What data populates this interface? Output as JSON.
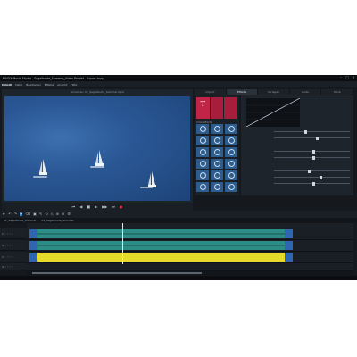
{
  "window": {
    "title": "MAGIX Movie Studio - Segelboote_Sommer_Video-Projekt - Export.mvp",
    "controls": [
      "–",
      "□",
      "✕"
    ]
  },
  "menu": {
    "items": [
      "MAGIX",
      "Datei",
      "Bearbeiten",
      "Effekte",
      "Ansicht",
      "Hilfe"
    ]
  },
  "preview": {
    "title": "Vorschau: 01_Segelboote_Sommer.mp4"
  },
  "transport": {
    "buttons": [
      "⏮",
      "◀",
      "■",
      "▶",
      "▶▶",
      "⏭",
      "●"
    ]
  },
  "right_tabs": [
    "Import",
    "Effekte",
    "Vorlagen",
    "Audio",
    "Store"
  ],
  "effects": {
    "title_tile": "T",
    "section_label": "Videoeffekte"
  },
  "toolbar": {
    "buttons": [
      "⇤",
      "↶",
      "↷",
      "✂",
      "⌫",
      "▣",
      "✎",
      "⟲",
      "◇",
      "⊕",
      "⊖",
      "⚙"
    ]
  },
  "timeline": {
    "tabs": [
      "01_Segelboote_Sommer",
      "02_Segelboote_Sommer"
    ],
    "tracks": [
      {
        "label": "1 ◦ ◦ ◦ ◦",
        "type": "video"
      },
      {
        "label": "2 ◦ ◦ ◦ ◦",
        "type": "video"
      },
      {
        "label": "3 ◦ ◦ ◦ ◦",
        "type": "audio"
      },
      {
        "label": "4 ◦ ◦ ◦ ◦",
        "type": "empty"
      }
    ]
  },
  "colors": {
    "accent": "#2f76b8",
    "video_clip": "#2c8d86",
    "audio_clip": "#e6db2a",
    "title_fx": "#c02446"
  }
}
